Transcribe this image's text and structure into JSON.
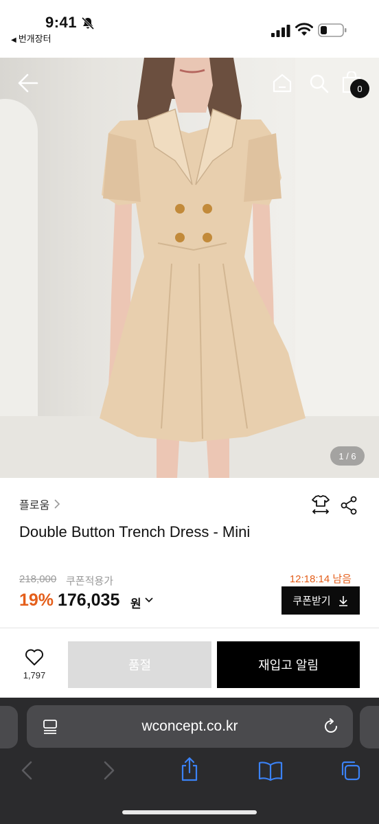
{
  "status_bar": {
    "time": "9:41",
    "back_app_label": "번개장터"
  },
  "hero": {
    "cart_count": "0",
    "image_counter": "1 / 6"
  },
  "product": {
    "brand": "플로움",
    "title": "Double Button Trench Dress - Mini",
    "original_price": "218,000",
    "coupon_label": "쿠폰적용가",
    "discount": "19%",
    "sale_price": "176,035",
    "currency": "원",
    "countdown": "12:18:14 남음",
    "coupon_button": "쿠폰받기"
  },
  "actions": {
    "wish_count": "1,797",
    "soldout_label": "품절",
    "restock_label": "재입고 알림"
  },
  "browser": {
    "url": "wconcept.co.kr"
  },
  "colors": {
    "accent": "#e45e1a",
    "primary_button": "#000000",
    "disabled_button": "#dcdcdc",
    "browser_bar": "#2b2b2d",
    "safari_blue": "#3b82f6"
  }
}
